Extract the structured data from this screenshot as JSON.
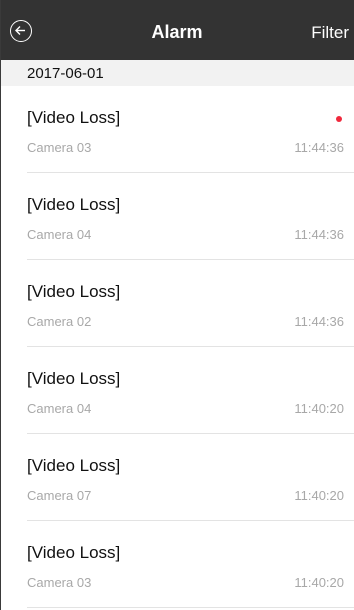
{
  "header": {
    "title": "Alarm",
    "filter_label": "Filter",
    "back_icon": "back-arrow-icon",
    "background": "#333333"
  },
  "date_header": "2017-06-01",
  "unread_color": "#f0283c",
  "alarms": [
    {
      "type": "[Video Loss]",
      "camera": "Camera 03",
      "time": "11:44:36",
      "unread": true
    },
    {
      "type": "[Video Loss]",
      "camera": "Camera 04",
      "time": "11:44:36",
      "unread": false
    },
    {
      "type": "[Video Loss]",
      "camera": "Camera 02",
      "time": "11:44:36",
      "unread": false
    },
    {
      "type": "[Video Loss]",
      "camera": "Camera 04",
      "time": "11:40:20",
      "unread": false
    },
    {
      "type": "[Video Loss]",
      "camera": "Camera 07",
      "time": "11:40:20",
      "unread": false
    },
    {
      "type": "[Video Loss]",
      "camera": "Camera 03",
      "time": "11:40:20",
      "unread": false
    }
  ]
}
